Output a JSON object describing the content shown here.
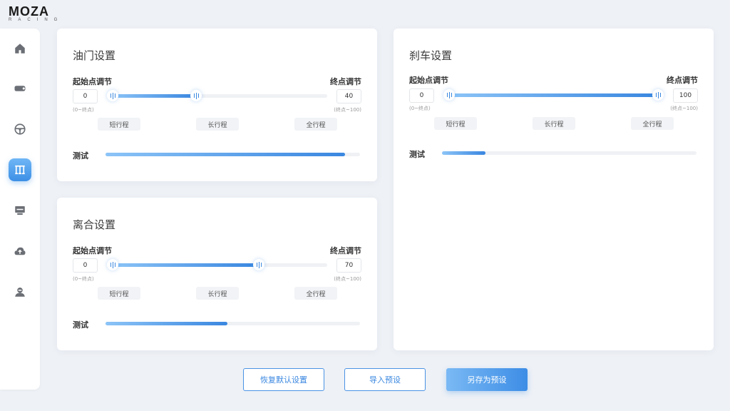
{
  "brand": {
    "name": "MOZA",
    "sub": "RACING"
  },
  "sidebar": {
    "items": [
      {
        "icon": "home-icon",
        "active": false
      },
      {
        "icon": "wheelbase-icon",
        "active": false
      },
      {
        "icon": "steering-wheel-icon",
        "active": false
      },
      {
        "icon": "pedals-icon",
        "active": true
      },
      {
        "icon": "dashboard-icon",
        "active": false
      },
      {
        "icon": "cloud-upload-icon",
        "active": false
      },
      {
        "icon": "user-icon",
        "active": false
      }
    ]
  },
  "common": {
    "start_label": "起始点调节",
    "end_label": "终点调节",
    "start_hint": "(0~终点)",
    "end_hint": "(终点~100)",
    "preset_short": "短行程",
    "preset_long": "长行程",
    "preset_full": "全行程",
    "test_label": "测试"
  },
  "throttle": {
    "title": "油门设置",
    "start": "0",
    "end": "40",
    "test_level": 0.94
  },
  "clutch": {
    "title": "离合设置",
    "start": "0",
    "end": "70",
    "test_level": 0.48
  },
  "brake": {
    "title": "刹车设置",
    "start": "0",
    "end": "100",
    "test_level": 0.17
  },
  "footer": {
    "reset_label": "恢复默认设置",
    "import_label": "导入预设",
    "save_label": "另存为预设"
  },
  "colors": {
    "accent": "#3a87e0",
    "accent_light": "#8cc4f7",
    "background": "#eef1f6"
  }
}
